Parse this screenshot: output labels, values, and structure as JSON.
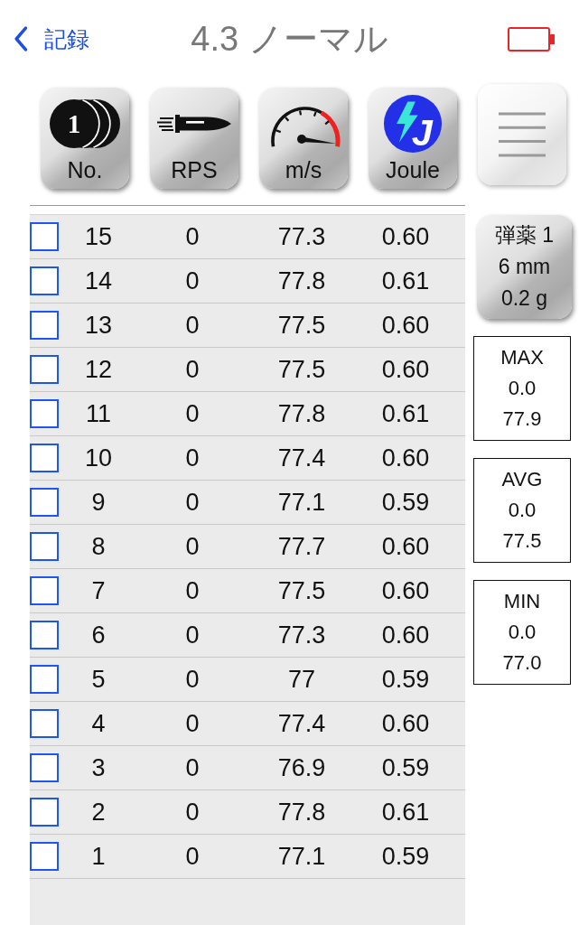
{
  "nav": {
    "back": "記録",
    "title": "4.3 ノーマル"
  },
  "toolbar": [
    {
      "kind": "count",
      "label": "No.",
      "badge": "1"
    },
    {
      "kind": "bullet",
      "label": "RPS"
    },
    {
      "kind": "speed",
      "label": "m/s"
    },
    {
      "kind": "energy",
      "label": "Joule",
      "badge": "J"
    },
    {
      "kind": "menu"
    }
  ],
  "shots": [
    {
      "checked": false,
      "no": "15",
      "rps": "0",
      "speed": "77.3",
      "joule": "0.60"
    },
    {
      "checked": false,
      "no": "14",
      "rps": "0",
      "speed": "77.8",
      "joule": "0.61"
    },
    {
      "checked": false,
      "no": "13",
      "rps": "0",
      "speed": "77.5",
      "joule": "0.60"
    },
    {
      "checked": false,
      "no": "12",
      "rps": "0",
      "speed": "77.5",
      "joule": "0.60"
    },
    {
      "checked": false,
      "no": "11",
      "rps": "0",
      "speed": "77.8",
      "joule": "0.61"
    },
    {
      "checked": false,
      "no": "10",
      "rps": "0",
      "speed": "77.4",
      "joule": "0.60"
    },
    {
      "checked": false,
      "no": "9",
      "rps": "0",
      "speed": "77.1",
      "joule": "0.59"
    },
    {
      "checked": false,
      "no": "8",
      "rps": "0",
      "speed": "77.7",
      "joule": "0.60"
    },
    {
      "checked": false,
      "no": "7",
      "rps": "0",
      "speed": "77.5",
      "joule": "0.60"
    },
    {
      "checked": false,
      "no": "6",
      "rps": "0",
      "speed": "77.3",
      "joule": "0.60"
    },
    {
      "checked": false,
      "no": "5",
      "rps": "0",
      "speed": "77",
      "joule": "0.59"
    },
    {
      "checked": false,
      "no": "4",
      "rps": "0",
      "speed": "77.4",
      "joule": "0.60"
    },
    {
      "checked": false,
      "no": "3",
      "rps": "0",
      "speed": "76.9",
      "joule": "0.59"
    },
    {
      "checked": false,
      "no": "2",
      "rps": "0",
      "speed": "77.8",
      "joule": "0.61"
    },
    {
      "checked": false,
      "no": "1",
      "rps": "0",
      "speed": "77.1",
      "joule": "0.59"
    }
  ],
  "ammo": {
    "name": "弾薬 1",
    "caliber": "6 mm",
    "weight": "0.2 g"
  },
  "stats": [
    {
      "label": "MAX",
      "rps": "0.0",
      "speed": "77.9"
    },
    {
      "label": "AVG",
      "rps": "0.0",
      "speed": "77.5"
    },
    {
      "label": "MIN",
      "rps": "0.0",
      "speed": "77.0"
    }
  ]
}
